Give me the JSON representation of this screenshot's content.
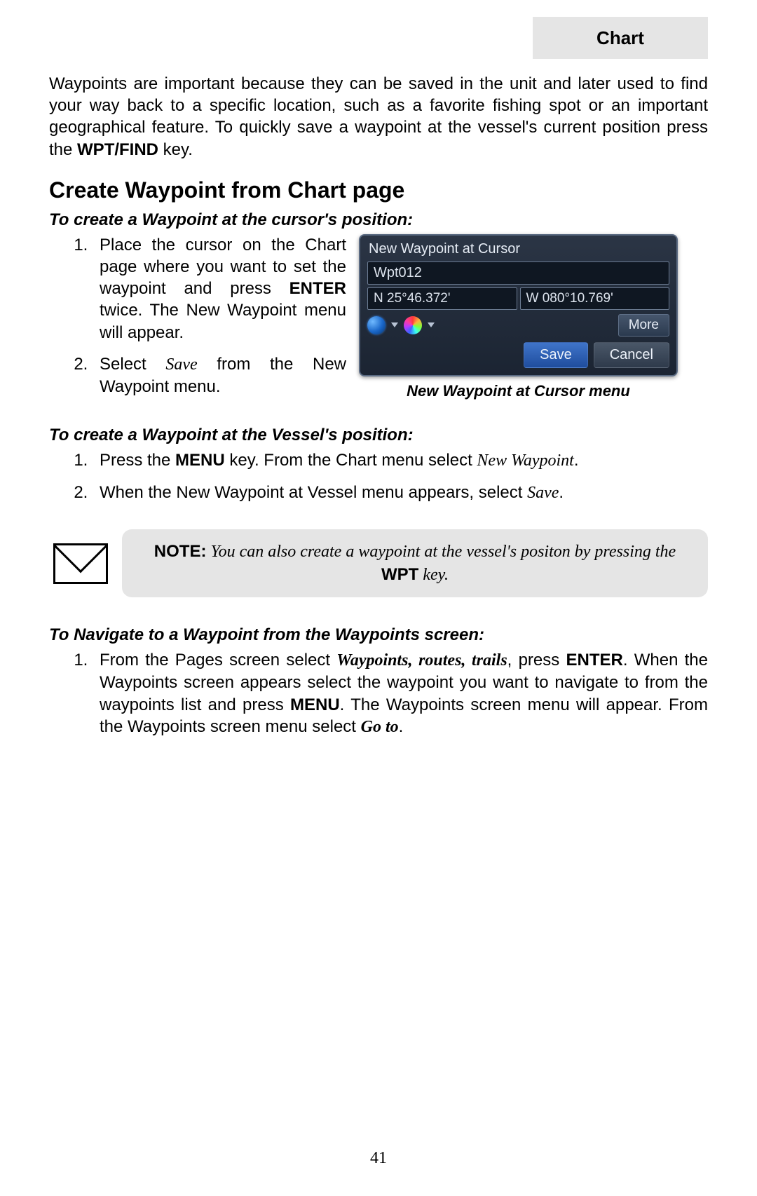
{
  "header": {
    "tab": "Chart"
  },
  "intro": {
    "pre": "Waypoints are important because they can be saved in the unit and later used to find your way back to a specific location, such as a favorite fishing spot or an important geographical feature. To quickly save a waypoint at the vessel's current position press the ",
    "key": "WPT/FIND",
    "post": " key."
  },
  "section_title": "Create Waypoint from Chart page",
  "cursor": {
    "heading": "To create a Waypoint at the cursor's position:",
    "step1_a": "Place the cursor on the Chart page where you want to set the waypoint and press ",
    "step1_key": "ENTER",
    "step1_b": " twice. The New Waypoint menu will appear.",
    "step2_a": "Select ",
    "step2_save": "Save",
    "step2_b": " from the New Waypoint menu."
  },
  "device": {
    "title": "New Waypoint at Cursor",
    "name": "Wpt012",
    "lat": "N 25°46.372'",
    "lon": "W 080°10.769'",
    "more": "More",
    "save": "Save",
    "cancel": "Cancel"
  },
  "device_caption": "New Waypoint at Cursor menu",
  "vessel": {
    "heading": "To create a Waypoint at the Vessel's position:",
    "step1_a": "Press the ",
    "step1_menu": "MENU",
    "step1_b": " key. From the Chart menu select ",
    "step1_nw": "New Waypoint",
    "step1_c": ".",
    "step2_a": "When the New Waypoint at Vessel menu appears, select ",
    "step2_save": "Save",
    "step2_b": "."
  },
  "note": {
    "lead": "NOTE:",
    "body_a": " You can also create a waypoint at the vessel's positon by pressing the ",
    "key": "WPT",
    "body_b": " key."
  },
  "navigate": {
    "heading": "To Navigate to a Waypoint from the Waypoints screen:",
    "a": "From the Pages screen select ",
    "wrt": "Waypoints, routes, trails",
    "b": ", press ",
    "enter": "ENTER",
    "c": ". When the Waypoints screen appears select the waypoint you want to navigate to from the waypoints list and press ",
    "menu": "MENU",
    "d": ". The Waypoints screen menu will appear. From the Waypoints screen menu select ",
    "goto": "Go to",
    "e": "."
  },
  "page_number": "41"
}
